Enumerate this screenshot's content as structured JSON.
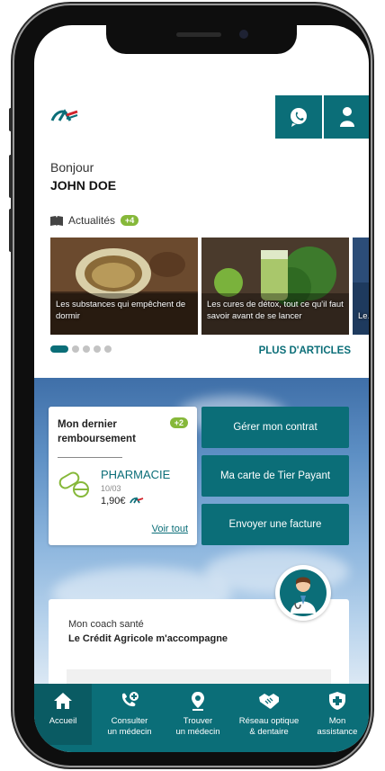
{
  "header": {
    "chat_icon": "chat-bubble-icon",
    "user_icon": "user-icon"
  },
  "greeting": {
    "hello": "Bonjour",
    "name": "JOHN DOE"
  },
  "news": {
    "label": "Actualités",
    "badge": "+4",
    "articles": [
      {
        "caption": "Les substances qui empêchent de dormir"
      },
      {
        "caption": "Les cures de détox, tout ce qu'il faut savoir avant de se lancer"
      },
      {
        "caption": "Le... de..."
      }
    ],
    "more_label": "PLUS D'ARTICLES"
  },
  "reimbursement": {
    "title": "Mon dernier remboursement",
    "badge": "+2",
    "category": "PHARMACIE",
    "date": "10/03",
    "amount": "1,90€",
    "see_all": "Voir tout"
  },
  "actions": {
    "manage_contract": "Gérer mon contrat",
    "tier_payant": "Ma carte de Tier Payant",
    "send_invoice": "Envoyer une facture"
  },
  "coach": {
    "subtitle": "Mon coach santé",
    "title": "Le Crédit Agricole m'accompagne"
  },
  "nav": {
    "items": [
      {
        "label": "Accueil",
        "icon": "home-icon"
      },
      {
        "label": "Consulter\nun médecin",
        "icon": "phone-medical-icon"
      },
      {
        "label": "Trouver\nun médecin",
        "icon": "location-pin-icon"
      },
      {
        "label": "Réseau optique\n& dentaire",
        "icon": "handshake-icon"
      },
      {
        "label": "Mon\nassistance",
        "icon": "shield-cross-icon"
      }
    ]
  },
  "colors": {
    "primary": "#0b6e78",
    "accent_green": "#86b83a"
  }
}
